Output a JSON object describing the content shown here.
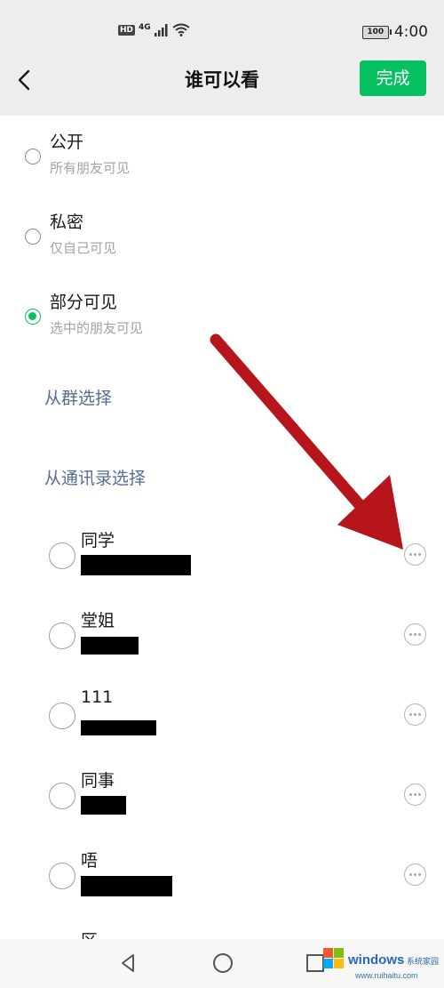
{
  "status_bar": {
    "hd": "HD",
    "network": "4G",
    "battery": "100",
    "time": "4:00"
  },
  "header": {
    "title": "谁可以看",
    "done_label": "完成",
    "back_icon": "back-chevron-icon"
  },
  "visibility_options": [
    {
      "title": "公开",
      "subtitle": "所有朋友可见",
      "selected": false
    },
    {
      "title": "私密",
      "subtitle": "仅自己可见",
      "selected": false
    },
    {
      "title": "部分可见",
      "subtitle": "选中的朋友可见",
      "selected": true
    }
  ],
  "links": {
    "from_group": "从群选择",
    "from_contacts": "从通讯录选择"
  },
  "tag_groups": [
    {
      "name": "同学"
    },
    {
      "name": "堂姐"
    },
    {
      "name": "111"
    },
    {
      "name": "同事"
    },
    {
      "name": "唔"
    },
    {
      "name": "区"
    }
  ],
  "watermark": {
    "brand": "windows系统家园",
    "url": "www.ruihaitu.com"
  },
  "colors": {
    "accent": "#07c160",
    "link": "#576b95",
    "annotation_arrow": "#b5151b"
  }
}
